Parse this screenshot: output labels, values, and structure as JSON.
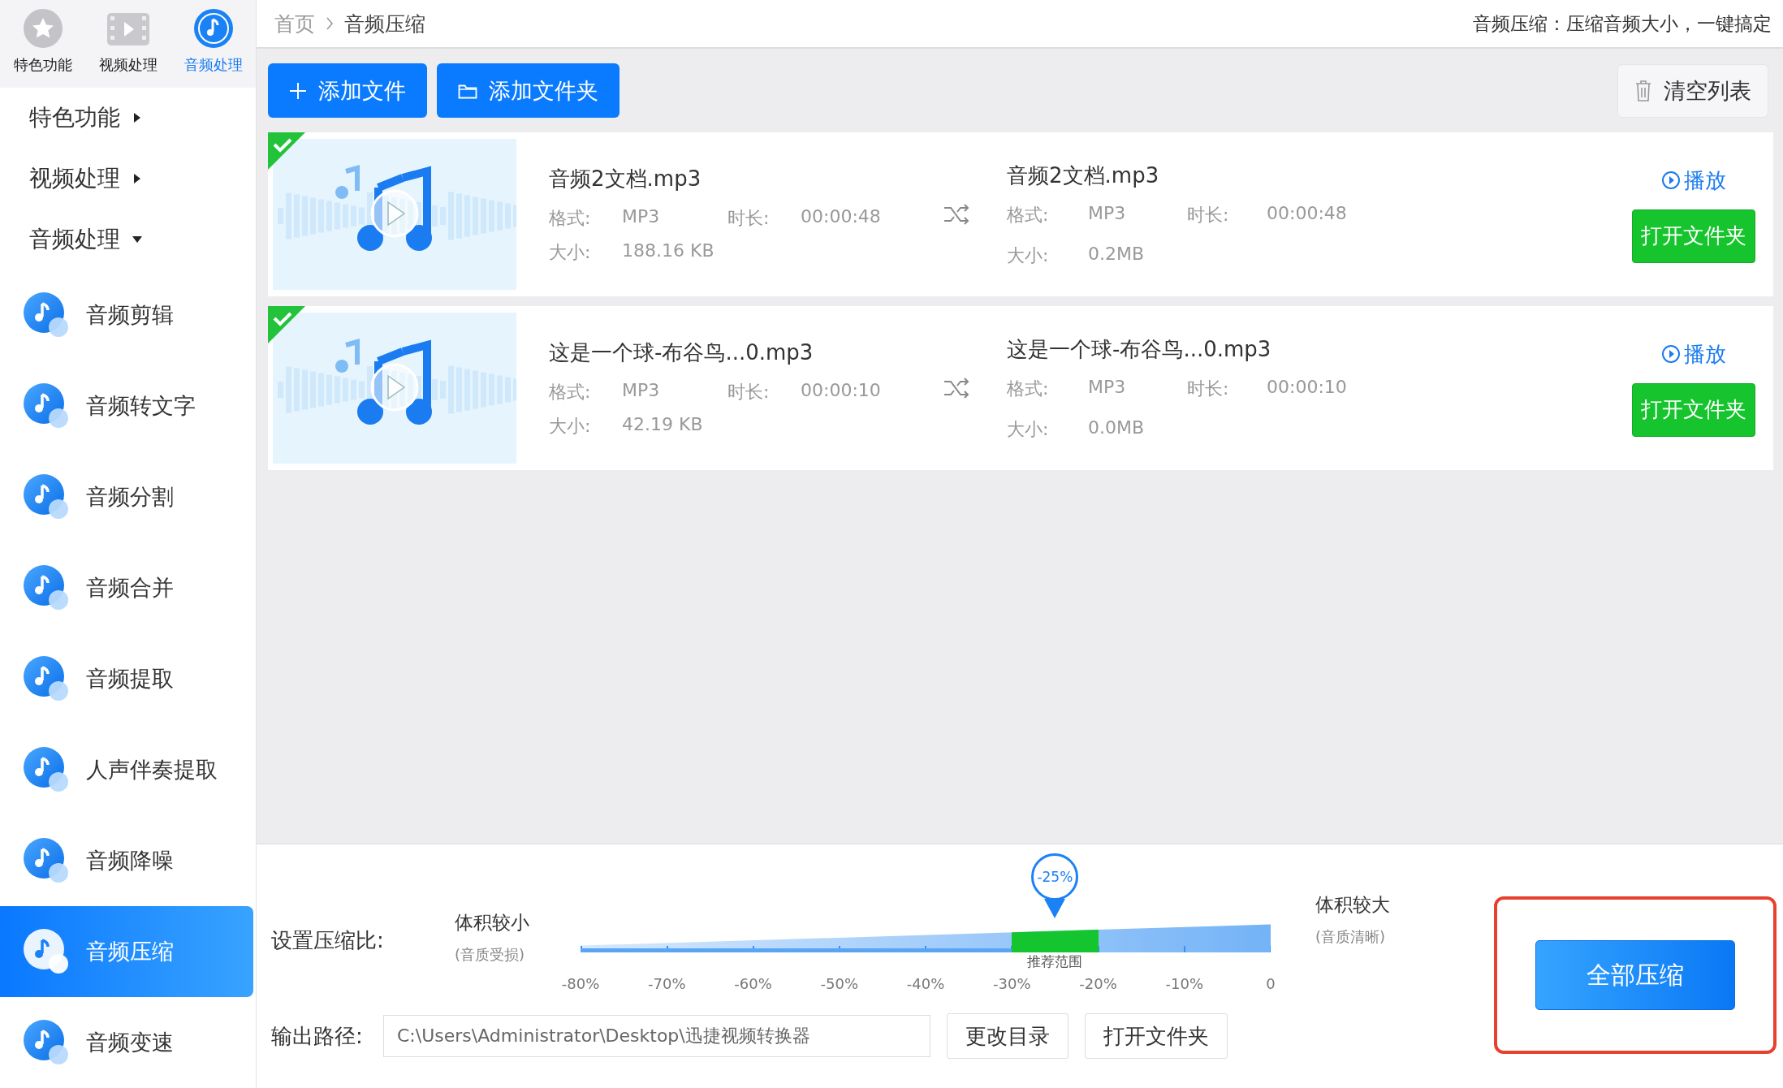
{
  "sidebar": {
    "top_tabs": [
      {
        "label": "特色功能",
        "kind": "star",
        "selected": false
      },
      {
        "label": "视频处理",
        "kind": "film",
        "selected": false
      },
      {
        "label": "音频处理",
        "kind": "music",
        "selected": true
      }
    ],
    "sections": [
      {
        "label": "特色功能",
        "expanded": false
      },
      {
        "label": "视频处理",
        "expanded": false
      },
      {
        "label": "音频处理",
        "expanded": true
      }
    ],
    "items": [
      {
        "label": "音频剪辑",
        "selected": false
      },
      {
        "label": "音频转文字",
        "selected": false
      },
      {
        "label": "音频分割",
        "selected": false
      },
      {
        "label": "音频合并",
        "selected": false
      },
      {
        "label": "音频提取",
        "selected": false
      },
      {
        "label": "人声伴奏提取",
        "selected": false
      },
      {
        "label": "音频降噪",
        "selected": false
      },
      {
        "label": "音频压缩",
        "selected": true
      },
      {
        "label": "音频变速",
        "selected": false
      }
    ]
  },
  "breadcrumb": [
    "首页",
    "音频压缩"
  ],
  "tagline": "音频压缩：压缩音频大小，一键搞定",
  "toolbar": {
    "buttons": [
      {
        "label": "添加文件",
        "kind": "add"
      },
      {
        "label": "添加文件夹",
        "kind": "folder"
      }
    ],
    "clear": "清空列表"
  },
  "files": [
    {
      "done": true,
      "source": {
        "name": "音频2文档.mp3",
        "format_label": "格式:",
        "format": "MP3",
        "duration_label": "时长:",
        "duration": "00:00:48",
        "size_label": "大小:",
        "size": "188.16 KB"
      },
      "output": {
        "name": "音频2文档.mp3",
        "format_label": "格式:",
        "format": "MP3",
        "duration_label": "时长:",
        "duration": "00:00:48",
        "size_label": "大小:",
        "size": "0.2MB"
      },
      "play": "播放",
      "open": "打开文件夹"
    },
    {
      "done": true,
      "source": {
        "name": "这是一个球-布谷鸟...0.mp3",
        "format_label": "格式:",
        "format": "MP3",
        "duration_label": "时长:",
        "duration": "00:00:10",
        "size_label": "大小:",
        "size": "42.19 KB"
      },
      "output": {
        "name": "这是一个球-布谷鸟...0.mp3",
        "format_label": "格式:",
        "format": "MP3",
        "duration_label": "时长:",
        "duration": "00:00:10",
        "size_label": "大小:",
        "size": "0.0MB"
      },
      "play": "播放",
      "open": "打开文件夹"
    }
  ],
  "compression": {
    "label": "设置压缩比:",
    "small": {
      "title": "体积较小",
      "note": "(音质受损)"
    },
    "large": {
      "title": "体积较大",
      "note": "(音质清晰)"
    },
    "level": 0.6875,
    "value_label": "-25%",
    "recommended": "推荐范围",
    "ticks": [
      "-80%",
      "-70%",
      "-60%",
      "-50%",
      "-40%",
      "-30%",
      "-20%",
      "-10%",
      "0"
    ]
  },
  "output": {
    "label": "输出路径:",
    "path": "C:\\Users\\Administrator\\Desktop\\迅捷视频转换器",
    "buttons": [
      "更改目录",
      "打开文件夹"
    ]
  },
  "compress_all": "全部压缩"
}
